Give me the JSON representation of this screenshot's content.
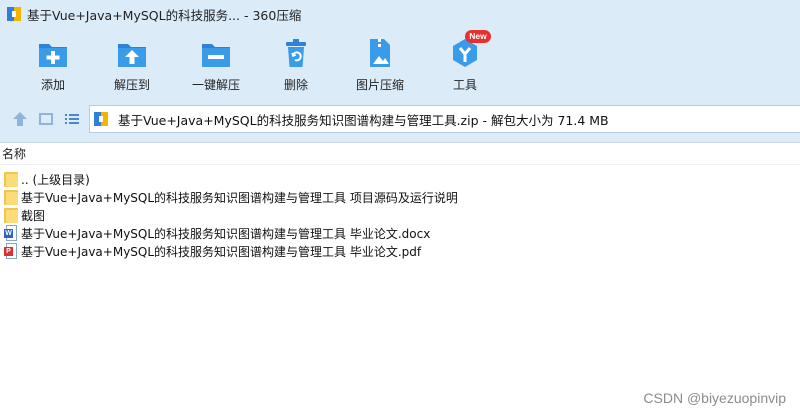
{
  "window": {
    "title": "基于Vue+Java+MySQL的科技服务... - 360压缩"
  },
  "toolbar": {
    "items": [
      {
        "label": "添加",
        "icon": "add-icon"
      },
      {
        "label": "解压到",
        "icon": "extract-to-icon"
      },
      {
        "label": "一键解压",
        "icon": "one-click-extract-icon"
      },
      {
        "label": "删除",
        "icon": "trash-icon"
      },
      {
        "label": "图片压缩",
        "icon": "image-compress-icon"
      },
      {
        "label": "工具",
        "icon": "tools-icon",
        "badge": "New"
      }
    ]
  },
  "addressbar": {
    "path": "基于Vue+Java+MySQL的科技服务知识图谱构建与管理工具.zip - 解包大小为 71.4 MB"
  },
  "filelist": {
    "column_name": "名称",
    "rows": [
      {
        "name": ".. (上级目录)",
        "type": "folder"
      },
      {
        "name": "基于Vue+Java+MySQL的科技服务知识图谱构建与管理工具 项目源码及运行说明",
        "type": "folder"
      },
      {
        "name": "截图",
        "type": "folder"
      },
      {
        "name": "基于Vue+Java+MySQL的科技服务知识图谱构建与管理工具 毕业论文.docx",
        "type": "docx"
      },
      {
        "name": "基于Vue+Java+MySQL的科技服务知识图谱构建与管理工具 毕业论文.pdf",
        "type": "pdf"
      }
    ]
  },
  "watermark": "CSDN @biyezuopinvip",
  "colors": {
    "accent_blue": "#2f8fe0",
    "badge_red": "#e8312f",
    "folder_yellow": "#f1c64a",
    "window_bg": "#dcebf8"
  }
}
